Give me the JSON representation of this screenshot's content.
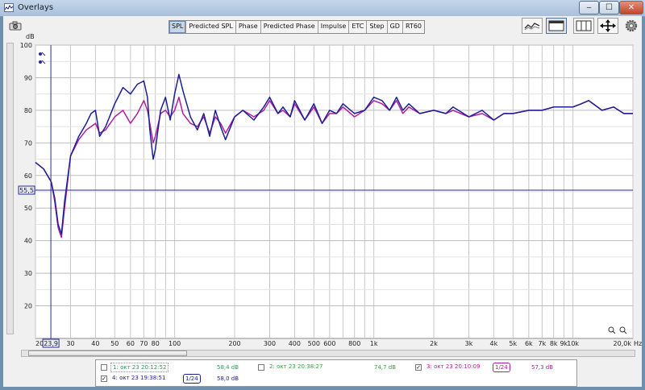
{
  "window": {
    "title": "Overlays",
    "minimize": "‒",
    "maximize": "☐",
    "close": "✕"
  },
  "tabs": [
    "SPL",
    "Predicted SPL",
    "Phase",
    "Predicted Phase",
    "Impulse",
    "ETC",
    "Step",
    "GD",
    "RT60"
  ],
  "active_tab": "SPL",
  "axis": {
    "y_unit": "dB",
    "y_ticks": [
      "100",
      "90",
      "80",
      "70",
      "60",
      "50",
      "40",
      "30",
      "20"
    ],
    "x_unit": "Hz",
    "x_ticks": [
      "20",
      "30",
      "40",
      "50",
      "60",
      "70",
      "80",
      "100",
      "200",
      "300",
      "400",
      "500",
      "600",
      "800",
      "1k",
      "2k",
      "3k",
      "4k",
      "5k",
      "6k",
      "7k",
      "8k",
      "9k",
      "10k",
      "20,0k"
    ],
    "cursor_y_label": "55,5",
    "cursor_x_label": "23,9"
  },
  "legend": [
    {
      "index": "1",
      "name": "окт 23 20:12:52",
      "value": "58,4 dB",
      "checked": false,
      "color": "#2e9b5a"
    },
    {
      "index": "2",
      "name": "окт 23 20:38:27",
      "value": "74,7 dB",
      "checked": false,
      "color": "#3aa043"
    },
    {
      "index": "3",
      "name": "окт 23 20:10:09",
      "value": "57,3 dB",
      "checked": true,
      "color": "#b01ea0",
      "smoothing": "1/24"
    },
    {
      "index": "4",
      "name": "окт 23 19:38:51",
      "value": "58,0 dB",
      "checked": true,
      "color": "#1d1f93",
      "smoothing": "1/24"
    }
  ],
  "chart_data": {
    "type": "line",
    "x_scale": "log",
    "xlim": [
      20,
      20000
    ],
    "ylim": [
      10,
      100
    ],
    "xlabel": "Hz",
    "ylabel": "dB",
    "grid": true,
    "cursor": {
      "x": 23.9,
      "y": 55.5
    },
    "series": [
      {
        "name": "окт 23 19:38:51",
        "color": "#1d1f93",
        "x": [
          20,
          22,
          24,
          25,
          26,
          27,
          28,
          30,
          33,
          36,
          38,
          40,
          42,
          45,
          50,
          55,
          60,
          65,
          70,
          73,
          75,
          78,
          80,
          85,
          90,
          95,
          100,
          105,
          110,
          120,
          130,
          140,
          150,
          160,
          170,
          180,
          200,
          220,
          250,
          280,
          300,
          330,
          350,
          380,
          400,
          450,
          500,
          550,
          600,
          650,
          700,
          800,
          900,
          1000,
          1100,
          1200,
          1300,
          1400,
          1500,
          1700,
          2000,
          2300,
          2500,
          3000,
          3500,
          4000,
          4500,
          5000,
          6000,
          7000,
          8000,
          9000,
          10000,
          11000,
          12000,
          14000,
          16000,
          18000,
          20000
        ],
        "y": [
          64,
          62,
          58,
          53,
          45,
          42,
          52,
          66,
          72,
          76,
          79,
          80,
          72,
          75,
          82,
          87,
          85,
          88,
          89,
          84,
          74,
          65,
          68,
          80,
          84,
          77,
          85,
          91,
          86,
          78,
          74,
          79,
          72,
          80,
          75,
          71,
          78,
          80,
          77,
          81,
          84,
          79,
          81,
          78,
          83,
          77,
          82,
          76,
          80,
          79,
          82,
          79,
          80,
          84,
          83,
          80,
          84,
          80,
          82,
          79,
          80,
          79,
          81,
          78,
          80,
          77,
          79,
          79,
          80,
          80,
          81,
          81,
          81,
          82,
          83,
          80,
          81,
          79,
          79
        ]
      },
      {
        "name": "окт 23 20:10:09",
        "color": "#b01ea0",
        "x": [
          20,
          22,
          24,
          25,
          26,
          27,
          28,
          30,
          33,
          36,
          38,
          40,
          42,
          45,
          50,
          55,
          60,
          65,
          70,
          73,
          75,
          78,
          80,
          85,
          90,
          95,
          100,
          105,
          110,
          120,
          130,
          140,
          150,
          160,
          170,
          180,
          200,
          220,
          250,
          280,
          300,
          330,
          350,
          380,
          400,
          450,
          500,
          550,
          600,
          650,
          700,
          800,
          900,
          1000,
          1100,
          1200,
          1300,
          1400,
          1500,
          1700,
          2000,
          2300,
          2500,
          3000,
          3500,
          4000,
          4500,
          5000,
          6000,
          7000,
          8000,
          9000,
          10000,
          11000,
          12000,
          14000,
          16000,
          18000,
          20000
        ],
        "y": [
          64,
          62,
          58,
          52,
          44,
          41,
          50,
          66,
          71,
          74,
          75,
          76,
          73,
          74,
          78,
          80,
          76,
          79,
          83,
          80,
          76,
          70,
          72,
          79,
          80,
          78,
          80,
          84,
          79,
          76,
          75,
          78,
          73,
          78,
          76,
          73,
          78,
          80,
          78,
          80,
          83,
          79,
          80,
          78,
          82,
          77,
          81,
          76,
          79,
          79,
          81,
          78,
          80,
          83,
          82,
          80,
          83,
          79,
          81,
          79,
          80,
          79,
          80,
          78,
          79,
          77,
          79,
          79,
          80,
          80,
          81,
          81,
          81,
          82,
          83,
          80,
          81,
          79,
          79
        ]
      }
    ]
  }
}
